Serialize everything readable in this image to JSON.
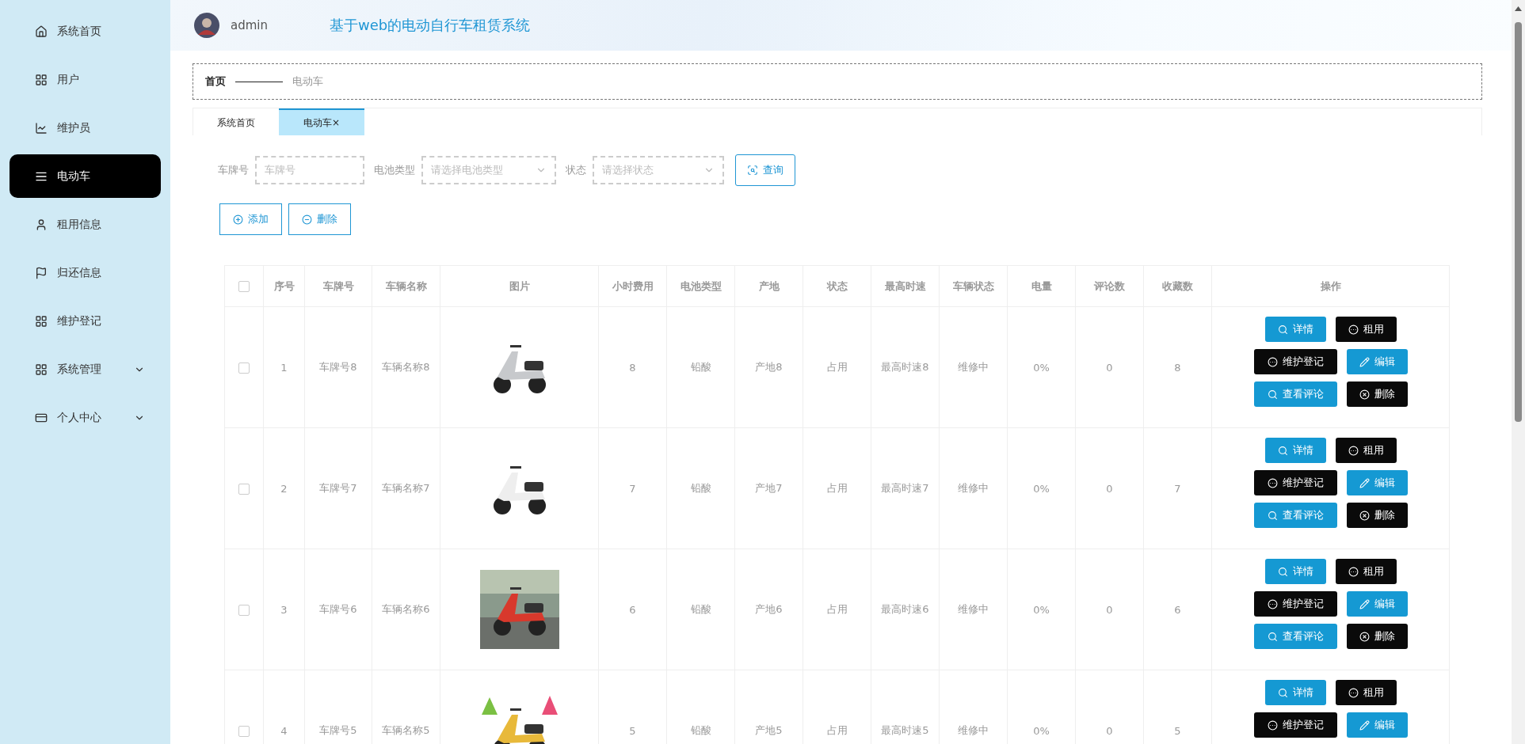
{
  "sidebar": {
    "items": [
      {
        "label": "系统首页",
        "selected": false
      },
      {
        "label": "用户",
        "selected": false
      },
      {
        "label": "维护员",
        "selected": false
      },
      {
        "label": "电动车",
        "selected": true
      },
      {
        "label": "租用信息",
        "selected": false
      },
      {
        "label": "归还信息",
        "selected": false
      },
      {
        "label": "维护登记",
        "selected": false
      },
      {
        "label": "系统管理",
        "selected": false,
        "expanded": false
      },
      {
        "label": "个人中心",
        "selected": false,
        "expanded": false
      }
    ]
  },
  "header": {
    "user": "admin",
    "title": "基于web的电动自行车租赁系统"
  },
  "breadcrumb": [
    "首页",
    "电动车"
  ],
  "tabs": [
    {
      "label": "系统首页",
      "selected": false
    },
    {
      "label": "电动车×",
      "selected": true
    }
  ],
  "filters": [
    {
      "kind": "input",
      "label": "车牌号",
      "placeholder": "车牌号"
    },
    {
      "kind": "select",
      "label": "电池类型",
      "placeholder": "请选择电池类型"
    },
    {
      "kind": "select",
      "label": "状态",
      "placeholder": "请选择状态"
    }
  ],
  "search_button": "查询",
  "toolbar": [
    "添加",
    "删除"
  ],
  "table": {
    "header_checked": false,
    "columns": [
      "序号",
      "车牌号",
      "车辆名称",
      "图片",
      "小时费用",
      "电池类型",
      "产地",
      "状态",
      "最高时速",
      "车辆状态",
      "电量",
      "评论数",
      "收藏数",
      "操作"
    ],
    "rows": [
      {
        "checked": false,
        "cells": [
          "1",
          "车牌号8",
          "车辆名称8",
          {
            "kind": "picture"
          },
          "8",
          "铅酸",
          "产地8",
          "占用",
          "最高时速8",
          "维修中",
          "0%",
          "0",
          "8"
        ],
        "actions": [
          {
            "label": "详情",
            "kind": "primary"
          },
          {
            "label": "租用",
            "kind": "dark"
          },
          {
            "label": "维护登记",
            "kind": "dark"
          },
          {
            "label": "编辑",
            "kind": "primary"
          },
          {
            "label": "查看评论",
            "kind": "primary"
          },
          {
            "label": "删除",
            "kind": "dark"
          }
        ]
      },
      {
        "checked": false,
        "cells": [
          "2",
          "车牌号7",
          "车辆名称7",
          {
            "kind": "picture"
          },
          "7",
          "铅酸",
          "产地7",
          "占用",
          "最高时速7",
          "维修中",
          "0%",
          "0",
          "7"
        ],
        "actions": [
          {
            "label": "详情",
            "kind": "primary"
          },
          {
            "label": "租用",
            "kind": "dark"
          },
          {
            "label": "维护登记",
            "kind": "dark"
          },
          {
            "label": "编辑",
            "kind": "primary"
          },
          {
            "label": "查看评论",
            "kind": "primary"
          },
          {
            "label": "删除",
            "kind": "dark"
          }
        ]
      },
      {
        "checked": false,
        "cells": [
          "3",
          "车牌号6",
          "车辆名称6",
          {
            "kind": "picture"
          },
          "6",
          "铅酸",
          "产地6",
          "占用",
          "最高时速6",
          "维修中",
          "0%",
          "0",
          "6"
        ],
        "actions": [
          {
            "label": "详情",
            "kind": "primary"
          },
          {
            "label": "租用",
            "kind": "dark"
          },
          {
            "label": "维护登记",
            "kind": "dark"
          },
          {
            "label": "编辑",
            "kind": "primary"
          },
          {
            "label": "查看评论",
            "kind": "primary"
          },
          {
            "label": "删除",
            "kind": "dark"
          }
        ]
      },
      {
        "checked": false,
        "cells": [
          "4",
          "车牌号5",
          "车辆名称5",
          {
            "kind": "picture"
          },
          "5",
          "铅酸",
          "产地5",
          "占用",
          "最高时速5",
          "维修中",
          "0%",
          "0",
          "5"
        ],
        "actions": [
          {
            "label": "详情",
            "kind": "primary"
          },
          {
            "label": "租用",
            "kind": "dark"
          },
          {
            "label": "维护登记",
            "kind": "dark"
          },
          {
            "label": "编辑",
            "kind": "primary"
          }
        ]
      }
    ]
  }
}
